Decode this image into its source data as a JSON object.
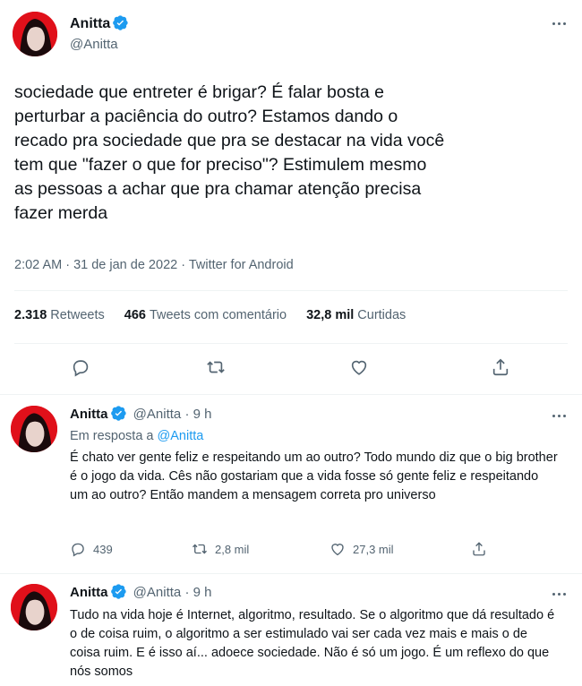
{
  "main_tweet": {
    "author_name": "Anitta",
    "author_handle": "@Anitta",
    "text": "sociedade que entreter é brigar? É falar bosta e\nperturbar a paciência do outro? Estamos dando o\nrecado pra sociedade que pra se destacar na vida você\ntem que \"fazer o que for preciso\"? Estimulem mesmo\nas pessoas a achar que pra chamar atenção precisa\nfazer merda",
    "time": "2:02 AM · 31 de jan de 2022 · Twitter for Android",
    "stats": {
      "retweets_count": "2.318",
      "retweets_label": "Retweets",
      "quotes_count": "466",
      "quotes_label": "Tweets com comentário",
      "likes_count": "32,8 mil",
      "likes_label": "Curtidas"
    }
  },
  "replies": [
    {
      "author_name": "Anitta",
      "author_handle": "@Anitta",
      "time": "· 9 h",
      "in_reply_prefix": "Em resposta a",
      "in_reply_handle": "@Anitta",
      "text": "É chato ver gente feliz e respeitando um ao outro? Todo mundo diz que o big brother é o jogo da vida. Cês não gostariam que a vida fosse só gente feliz e respeitando um ao outro? Então mandem a mensagem correta pro universo",
      "reply_count": "439",
      "retweet_count": "2,8 mil",
      "like_count": "27,3 mil"
    },
    {
      "author_name": "Anitta",
      "author_handle": "@Anitta",
      "time": "· 9 h",
      "text": "Tudo na vida hoje é Internet, algoritmo, resultado. Se o algoritmo que dá resultado é o de coisa ruim, o algoritmo a ser estimulado vai ser cada vez mais e mais o de coisa ruim. E é isso aí... adoece sociedade. Não é só um jogo. É um reflexo do que nós somos"
    }
  ],
  "colors": {
    "accent": "#1d9bf0",
    "text": "#0f1419",
    "secondary": "#536471",
    "avatar_bg": "#e0101a"
  },
  "icons": [
    "verified-badge-icon",
    "more-icon",
    "reply-icon",
    "retweet-icon",
    "like-icon",
    "share-icon"
  ]
}
